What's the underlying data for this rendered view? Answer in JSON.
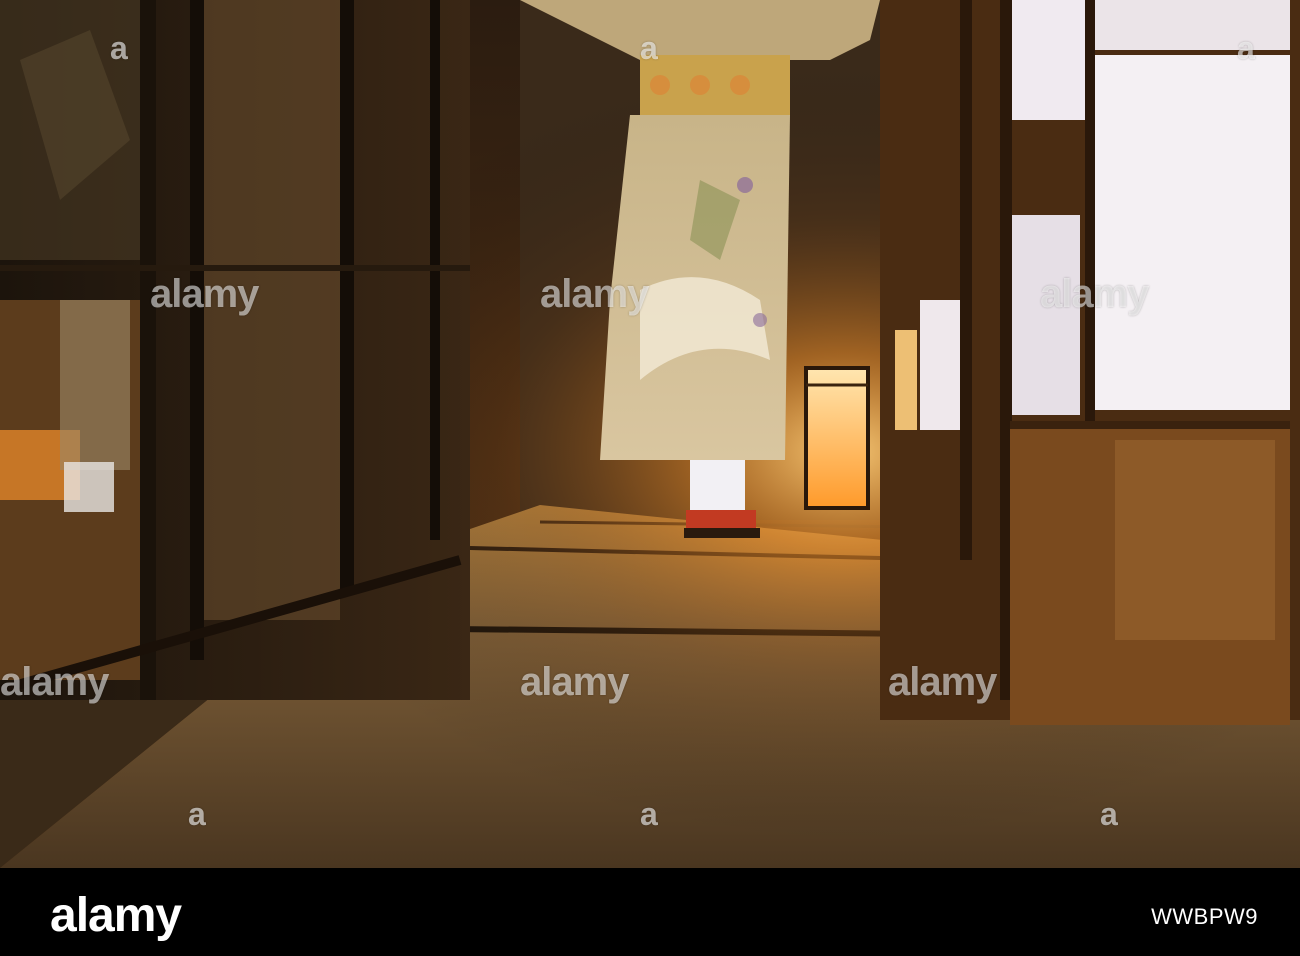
{
  "watermark": {
    "text": "alamy",
    "marker": "a"
  },
  "footer": {
    "brand": "alamy",
    "image_id": "WWBPW9"
  },
  "colors": {
    "lantern_glow": "#ffb347",
    "kimono": "#cdb88c",
    "tatami": "#6b5334",
    "shoji_paper": "#f4f0f3",
    "wood_dark": "#3a2412",
    "footer_bg": "#000000"
  }
}
